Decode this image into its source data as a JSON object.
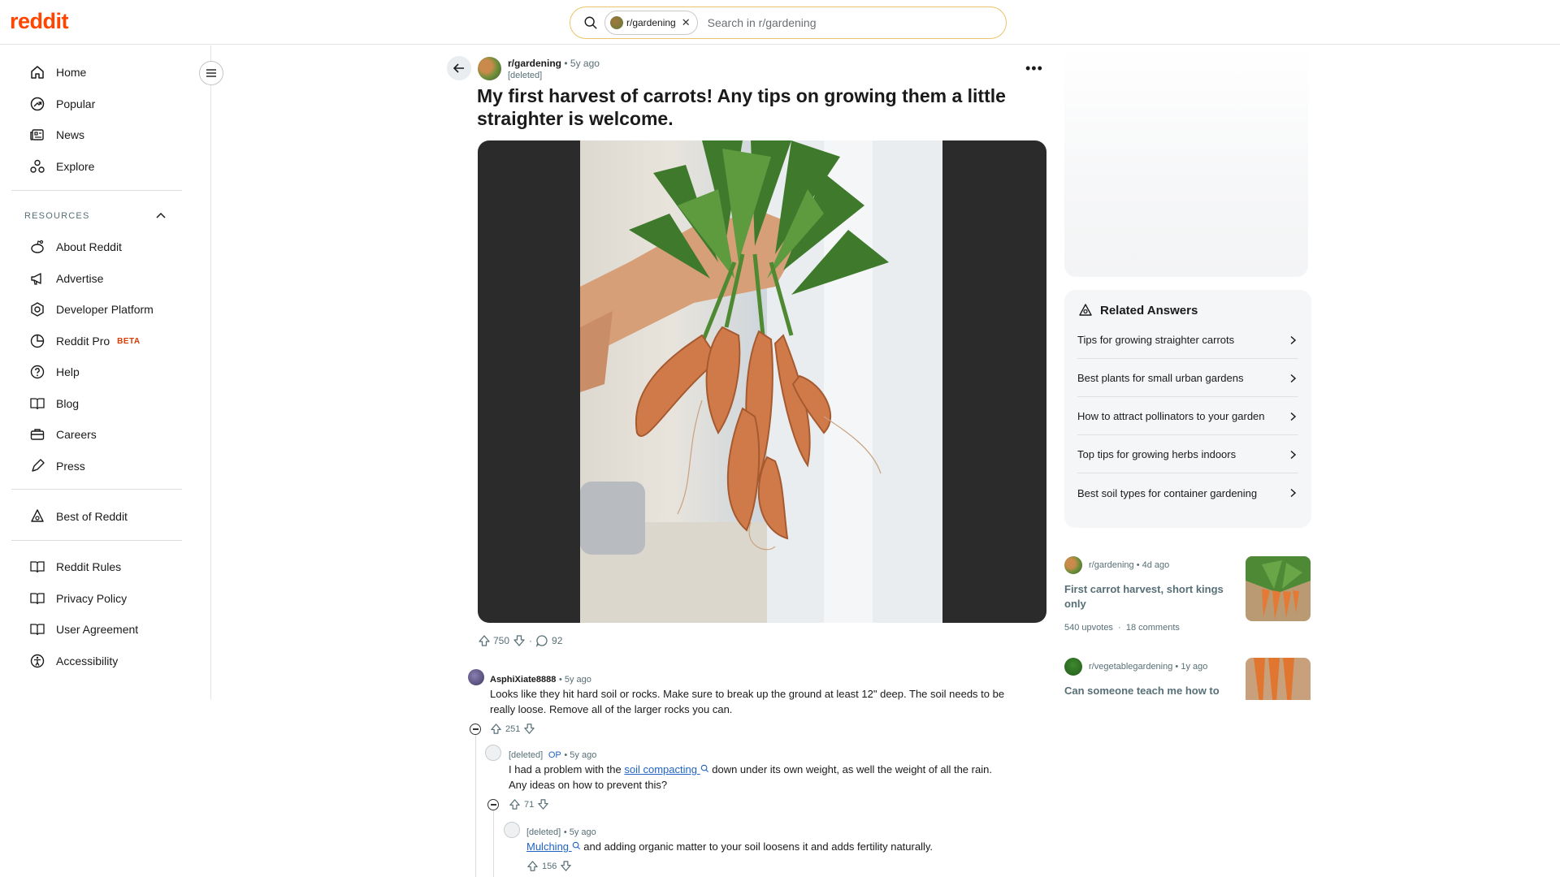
{
  "header": {
    "logo": "reddit",
    "search_chip": "r/gardening",
    "search_placeholder": "Search in r/gardening"
  },
  "sidebar": {
    "nav": [
      {
        "label": "Home",
        "icon": "home-icon"
      },
      {
        "label": "Popular",
        "icon": "popular-icon"
      },
      {
        "label": "News",
        "icon": "news-icon"
      },
      {
        "label": "Explore",
        "icon": "explore-icon"
      }
    ],
    "resources_label": "RESOURCES",
    "resources": [
      {
        "label": "About Reddit",
        "icon": "reddit-alien-icon"
      },
      {
        "label": "Advertise",
        "icon": "megaphone-icon"
      },
      {
        "label": "Developer Platform",
        "icon": "developer-icon"
      },
      {
        "label": "Reddit Pro",
        "icon": "pro-icon",
        "badge": "BETA"
      },
      {
        "label": "Help",
        "icon": "help-icon"
      },
      {
        "label": "Blog",
        "icon": "blog-icon"
      },
      {
        "label": "Careers",
        "icon": "briefcase-icon"
      },
      {
        "label": "Press",
        "icon": "press-icon"
      }
    ],
    "best_of": "Best of Reddit",
    "policies": [
      {
        "label": "Reddit Rules",
        "icon": "rules-icon"
      },
      {
        "label": "Privacy Policy",
        "icon": "privacy-icon"
      },
      {
        "label": "User Agreement",
        "icon": "agreement-icon"
      },
      {
        "label": "Accessibility",
        "icon": "accessibility-icon"
      }
    ]
  },
  "post": {
    "subreddit": "r/gardening",
    "time": "5y ago",
    "author": "[deleted]",
    "title": "My first harvest of carrots! Any tips on growing them a little straighter is welcome.",
    "upvotes": "750",
    "comments": "92"
  },
  "comments": [
    {
      "author": "AsphiXiate8888",
      "time": "5y ago",
      "body": "Looks like they hit hard soil or rocks. Make sure to break up the ground at least 12\" deep. The soil needs to be really loose. Remove all of the larger rocks you can.",
      "votes": "251"
    },
    {
      "author": "[deleted]",
      "op": "OP",
      "time": "5y ago",
      "body_before": "I had a problem with the",
      "keyword": "soil compacting",
      "body_after": "down under its own weight, as well the weight of all the rain. Any ideas on how to prevent this?",
      "votes": "71"
    },
    {
      "author": "[deleted]",
      "time": "5y ago",
      "keyword": "Mulching",
      "body_after": "and adding organic matter to your soil loosens it and adds fertility naturally.",
      "votes": "156"
    }
  ],
  "related_answers": {
    "title": "Related Answers",
    "items": [
      "Tips for growing straighter carrots",
      "Best plants for small urban gardens",
      "How to attract pollinators to your garden",
      "Top tips for growing herbs indoors",
      "Best soil types for container gardening"
    ]
  },
  "related_posts": [
    {
      "subreddit": "r/gardening",
      "time": "4d ago",
      "title": "First carrot harvest, short kings only",
      "upvotes": "540 upvotes",
      "comments": "18 comments"
    },
    {
      "subreddit": "r/vegetablegardening",
      "time": "1y ago",
      "title": "Can someone teach me how to"
    }
  ],
  "colors": {
    "brand": "#ff4500",
    "link": "#1e63c4",
    "search_border": "#e9c46a"
  }
}
